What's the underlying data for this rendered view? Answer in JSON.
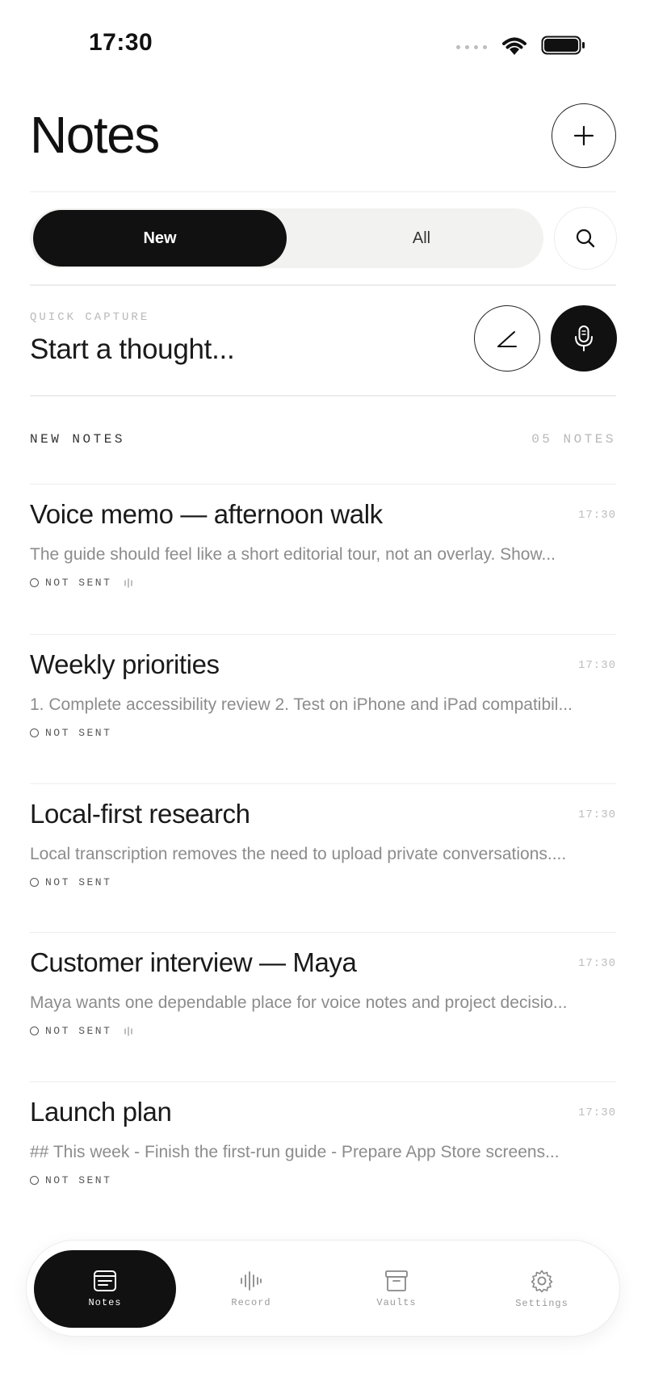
{
  "status_bar": {
    "time": "17:30"
  },
  "header": {
    "title": "Notes"
  },
  "filter": {
    "new_label": "New",
    "all_label": "All"
  },
  "quick_capture": {
    "label": "QUICK CAPTURE",
    "placeholder": "Start a thought..."
  },
  "section": {
    "title": "NEW NOTES",
    "count": "05 NOTES"
  },
  "notes": [
    {
      "title": "Voice memo — afternoon walk",
      "time": "17:30",
      "preview": "The guide should feel like a short editorial tour, not an overlay. Show...",
      "status": "NOT SENT",
      "has_audio": true
    },
    {
      "title": "Weekly priorities",
      "time": "17:30",
      "preview": "1. Complete accessibility review 2. Test on iPhone and iPad compatibil...",
      "status": "NOT SENT",
      "has_audio": false
    },
    {
      "title": "Local-first research",
      "time": "17:30",
      "preview": "Local transcription removes the need to upload private conversations....",
      "status": "NOT SENT",
      "has_audio": false
    },
    {
      "title": "Customer interview — Maya",
      "time": "17:30",
      "preview": "Maya wants one dependable place for voice notes and project decisio...",
      "status": "NOT SENT",
      "has_audio": true
    },
    {
      "title": "Launch plan",
      "time": "17:30",
      "preview": "## This week - Finish the first-run guide - Prepare App Store screens...",
      "status": "NOT SENT",
      "has_audio": false
    }
  ],
  "tabbar": {
    "tabs": [
      {
        "label": "Notes",
        "icon": "notes-icon",
        "active": true
      },
      {
        "label": "Record",
        "icon": "waveform-icon",
        "active": false
      },
      {
        "label": "Vaults",
        "icon": "archive-icon",
        "active": false
      },
      {
        "label": "Settings",
        "icon": "gear-icon",
        "active": false
      }
    ]
  },
  "colors": {
    "accent": "#111111",
    "background": "#ffffff",
    "muted": "#8c8c8c",
    "divider": "#ececec"
  }
}
